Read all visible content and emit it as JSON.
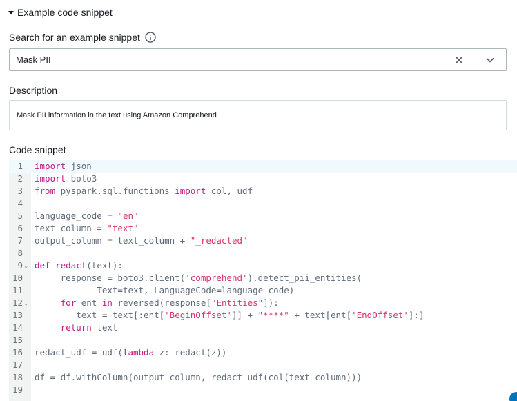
{
  "section": {
    "title": "Example code snippet"
  },
  "search": {
    "label": "Search for an example snippet",
    "value": "Mask PII"
  },
  "description": {
    "label": "Description",
    "text": "Mask PII information in the text using Amazon Comprehend"
  },
  "code": {
    "label": "Code snippet",
    "lines": [
      {
        "n": "1",
        "fold": "",
        "html": "<span class=\"kw\">import</span> json"
      },
      {
        "n": "2",
        "fold": "",
        "html": "<span class=\"kw\">import</span> boto3"
      },
      {
        "n": "3",
        "fold": "",
        "html": "<span class=\"kw\">from</span> pyspark.sql.functions <span class=\"kw\">import</span> col, udf"
      },
      {
        "n": "4",
        "fold": "",
        "html": ""
      },
      {
        "n": "5",
        "fold": "",
        "html": "language_code = <span class=\"str\">\"en\"</span>"
      },
      {
        "n": "6",
        "fold": "",
        "html": "text_column = <span class=\"str\">\"text\"</span>"
      },
      {
        "n": "7",
        "fold": "",
        "html": "output_column = text_column + <span class=\"str\">\"_redacted\"</span>"
      },
      {
        "n": "8",
        "fold": "",
        "html": ""
      },
      {
        "n": "9",
        "fold": "⌄",
        "html": "<span class=\"kw\">def</span> <span class=\"fn\">redact</span>(text):"
      },
      {
        "n": "10",
        "fold": "",
        "html": "     response = boto3.client(<span class=\"str\">'comprehend'</span>).detect_pii_entities("
      },
      {
        "n": "11",
        "fold": "",
        "html": "            Text=text, LanguageCode=language_code)"
      },
      {
        "n": "12",
        "fold": "⌄",
        "html": "     <span class=\"kw\">for</span> ent <span class=\"kw\">in</span> reversed(response[<span class=\"str\">\"Entities\"</span>]):"
      },
      {
        "n": "13",
        "fold": "",
        "html": "        text = text[:ent[<span class=\"str\">'BeginOffset'</span>]] + <span class=\"str\">\"****\"</span> + text[ent[<span class=\"str\">'EndOffset'</span>]:]"
      },
      {
        "n": "14",
        "fold": "",
        "html": "     <span class=\"kw\">return</span> text"
      },
      {
        "n": "15",
        "fold": "",
        "html": ""
      },
      {
        "n": "16",
        "fold": "",
        "html": "redact_udf = udf(<span class=\"kw\">lambda</span> z: redact(z))"
      },
      {
        "n": "17",
        "fold": "",
        "html": ""
      },
      {
        "n": "18",
        "fold": "",
        "html": "df = df.withColumn(output_column, redact_udf(col(text_column)))"
      },
      {
        "n": "19",
        "fold": "",
        "html": ""
      }
    ]
  }
}
